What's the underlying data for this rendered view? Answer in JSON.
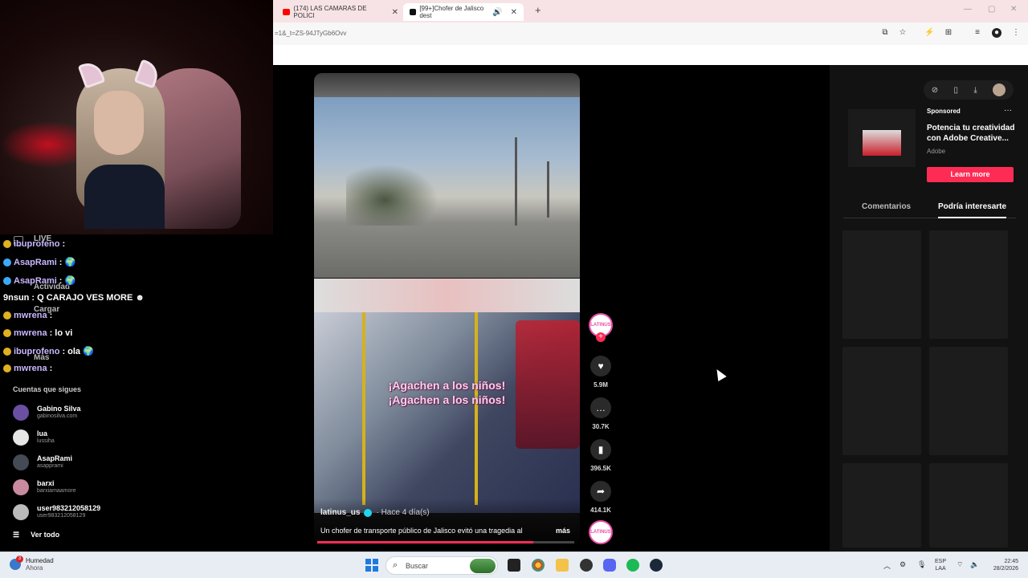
{
  "browser": {
    "tabs": [
      {
        "label": "(174) LAS CAMARAS DE POLICI",
        "favicon_color": "#ff0000"
      },
      {
        "label": "[99+]Chofer de Jalisco dest",
        "favicon_color": "#111111"
      }
    ],
    "new_tab": "+",
    "url": "=1&_t=ZS-94JTyGb6Ovv"
  },
  "video": {
    "subtitle_line1": "¡Agachen a los niños!",
    "subtitle_line2": "¡Agachen a los niños!",
    "author": "latinus_us",
    "ago": "· Hace 4 día(s)",
    "caption": "Un chofer de transporte público de Jalisco evitó una tragedia al",
    "more": "más",
    "progress": 0.84
  },
  "actions": {
    "profile_label": "LATINUS",
    "likes": "5.9M",
    "comments": "30.7K",
    "saves": "396.5K",
    "shares": "414.1K"
  },
  "ad": {
    "sponsored": "Sponsored",
    "menu": "···",
    "title": "Potencia tu creatividad con Adobe Creative...",
    "brand": "Adobe",
    "cta": "Learn more"
  },
  "right_tabs": {
    "comments": "Comentarios",
    "suggested": "Podría interesarte"
  },
  "chat": [
    {
      "name": "ibuprofeno",
      "text": ":",
      "badge": "#e0b020"
    },
    {
      "name": "AsapRami",
      "text": ":",
      "badge": "#3da9fc"
    },
    {
      "name": "AsapRami",
      "text": ":",
      "badge": "#3da9fc"
    },
    {
      "name": "9nsun",
      "text": ": Q CARAJO VES MORE",
      "badge": ""
    },
    {
      "name": "mwrena",
      "text": ":",
      "badge": "#e0b020"
    },
    {
      "name": "mwrena",
      "text": ": lo vi",
      "badge": "#e0b020"
    },
    {
      "name": "ibuprofeno",
      "text": ": ola",
      "badge": "#e0b020"
    },
    {
      "name": "mwrena",
      "text": ":",
      "badge": "#e0b020"
    }
  ],
  "nav_ghost": {
    "live": "LIVE",
    "activity": "Actividad",
    "upload": "Cargar",
    "more": "Más"
  },
  "following": {
    "title": "Cuentas que sigues",
    "items": [
      {
        "name": "Gabino Silva",
        "handle": "gabinosilva.com",
        "color": "#6b4fa3"
      },
      {
        "name": "lua",
        "handle": "lussiha",
        "color": "#e6e6e6"
      },
      {
        "name": "AsapRami",
        "handle": "asapprami",
        "color": "#444b55"
      },
      {
        "name": "barxi",
        "handle": "barxiamaamore",
        "color": "#c98aa0"
      },
      {
        "name": "user983212058129",
        "handle": "user983212058129",
        "color": "#bbbbbb"
      }
    ],
    "see_all": "Ver todo"
  },
  "taskbar": {
    "weather_title": "Humedad",
    "weather_sub": "Ahora",
    "weather_badge": "3",
    "search": "Buscar",
    "lang1": "ESP",
    "lang2": "LAA",
    "time": "22:45",
    "date": "28/2/2026"
  }
}
